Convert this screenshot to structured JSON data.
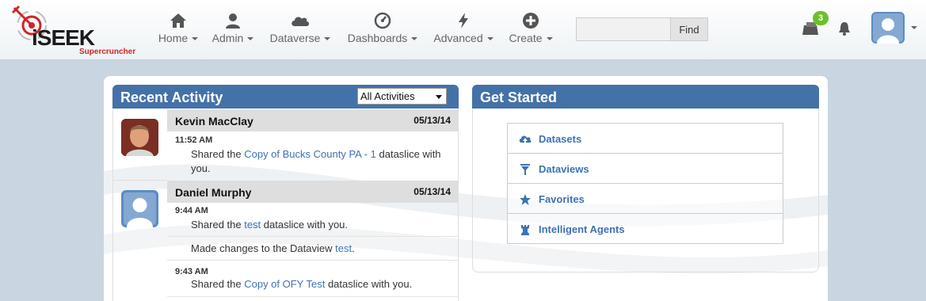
{
  "brand": {
    "name": "iSEEK",
    "tagline": "Supercruncher"
  },
  "nav": [
    {
      "label": "Home",
      "icon": "home-icon"
    },
    {
      "label": "Admin",
      "icon": "user-icon"
    },
    {
      "label": "Dataverse",
      "icon": "cloud-icon"
    },
    {
      "label": "Dashboards",
      "icon": "gauge-icon"
    },
    {
      "label": "Advanced",
      "icon": "bolt-icon"
    },
    {
      "label": "Create",
      "icon": "plus-circle-icon"
    }
  ],
  "search": {
    "value": "",
    "button_label": "Find"
  },
  "notifications": {
    "message_count": "3"
  },
  "colors": {
    "header_blue": "#4472a8",
    "link_blue": "#3d72b4",
    "badge_green": "#6bbf2e"
  },
  "recent_activity": {
    "title": "Recent Activity",
    "filter_selected": "All Activities",
    "entries": [
      {
        "user": "Kevin MacClay",
        "date": "05/13/14",
        "items": [
          {
            "time": "11:52 AM",
            "prefix": "Shared the ",
            "link": "Copy of Bucks County PA - 1",
            "suffix": " dataslice with",
            "cont": "you."
          }
        ]
      },
      {
        "user": "Daniel Murphy",
        "date": "05/13/14",
        "items": [
          {
            "time": "9:44 AM",
            "prefix": "Shared the ",
            "link": "test",
            "suffix": " dataslice with you."
          },
          {
            "time": "",
            "prefix": "Made changes to the Dataview ",
            "link": "test",
            "suffix": "."
          },
          {
            "time": "9:43 AM",
            "prefix": "Shared the ",
            "link": "Copy of OFY Test",
            "suffix": " dataslice with you."
          }
        ]
      }
    ]
  },
  "get_started": {
    "title": "Get Started",
    "items": [
      {
        "label": "Datasets",
        "icon": "cloud-upload-icon"
      },
      {
        "label": "Dataviews",
        "icon": "filter-icon"
      },
      {
        "label": "Favorites",
        "icon": "star-icon"
      },
      {
        "label": "Intelligent Agents",
        "icon": "chess-rook-icon"
      }
    ]
  }
}
